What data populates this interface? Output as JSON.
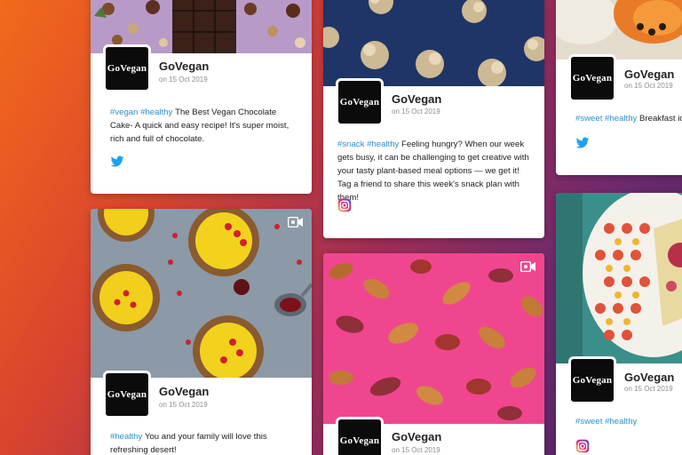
{
  "brand": {
    "name": "GoVegan",
    "logo_text": "GoVegan"
  },
  "colors": {
    "hashtag": "#2d91c7",
    "twitter": "#1da1f2",
    "instagram_gradient": [
      "#feda75",
      "#d62976",
      "#4f5bd5"
    ]
  },
  "posts": [
    {
      "author": "GoVegan",
      "date": "on 15 Oct 2019",
      "hashtags": "#vegan #healthy",
      "text": "The Best Vegan Chocolate Cake- A quick and easy recipe! It's super moist, rich and full of chocolate.",
      "network_icon": "twitter-icon"
    },
    {
      "author": "GoVegan",
      "date": "on 15 Oct 2019",
      "hashtags": "#healthy",
      "text": "You and your family will love this refreshing desert!",
      "media_icon": "video-camera-icon"
    },
    {
      "author": "GoVegan",
      "date": "on 15 Oct 2019",
      "hashtags": "#snack #healthy",
      "text": "Feeling hungry? When our week gets busy, it can be challenging to get creative with your tasty plant-based meal options — we get it! Tag a friend to share this week's snack plan with them!",
      "network_icon": "instagram-icon"
    },
    {
      "author": "GoVegan",
      "date": "on 15 Oct 2019",
      "media_icon": "video-camera-icon"
    },
    {
      "author": "GoVegan",
      "date": "on 15 Oct 2019",
      "hashtags": "#sweet #healthy",
      "text": "Breakfast ide",
      "network_icon": "twitter-icon"
    },
    {
      "author": "GoVegan",
      "date": "on 15 Oct 2019",
      "hashtags": "#sweet #healthy",
      "network_icon": "instagram-icon"
    }
  ]
}
